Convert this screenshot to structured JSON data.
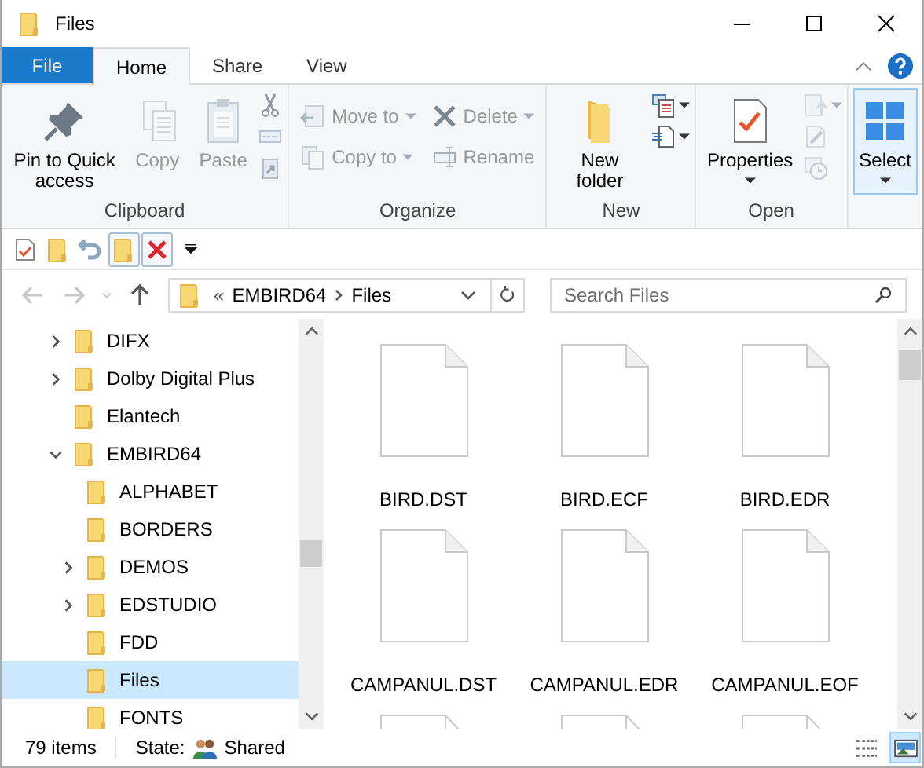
{
  "window": {
    "title": "Files"
  },
  "tabs": [
    {
      "label": "File",
      "kind": "file",
      "selected": false
    },
    {
      "label": "Home",
      "kind": "tab",
      "selected": true
    },
    {
      "label": "Share",
      "kind": "tab",
      "selected": false
    },
    {
      "label": "View",
      "kind": "tab",
      "selected": false
    }
  ],
  "ribbon": {
    "groups": [
      {
        "name": "Clipboard",
        "items": [
          {
            "kind": "large",
            "label": "Pin to Quick access",
            "disabled": false,
            "dropdown": false
          },
          {
            "kind": "large",
            "label": "Copy",
            "disabled": true,
            "dropdown": false
          },
          {
            "kind": "large",
            "label": "Paste",
            "disabled": true,
            "dropdown": false
          },
          {
            "kind": "stack",
            "buttons": [
              {
                "disabled": false,
                "dropdown": false
              },
              {
                "disabled": true,
                "dropdown": false
              },
              {
                "disabled": true,
                "dropdown": false
              }
            ]
          }
        ]
      },
      {
        "name": "Organize",
        "items": [
          {
            "kind": "column",
            "buttons": [
              {
                "label": "Move to",
                "disabled": true,
                "dropdown": true
              },
              {
                "label": "Copy to",
                "disabled": true,
                "dropdown": true
              }
            ]
          },
          {
            "kind": "column",
            "buttons": [
              {
                "label": "Delete",
                "disabled": true,
                "dropdown": true
              },
              {
                "label": "Rename",
                "disabled": true,
                "dropdown": false
              }
            ]
          }
        ]
      },
      {
        "name": "New",
        "items": [
          {
            "kind": "large",
            "label": "New folder",
            "disabled": false,
            "dropdown": false
          },
          {
            "kind": "stack",
            "buttons": [
              {
                "disabled": false,
                "dropdown": true
              },
              {
                "disabled": false,
                "dropdown": true
              }
            ]
          }
        ]
      },
      {
        "name": "Open",
        "items": [
          {
            "kind": "large",
            "label": "Properties",
            "disabled": false,
            "dropdown": true
          },
          {
            "kind": "stack",
            "buttons": [
              {
                "disabled": true,
                "dropdown": true
              },
              {
                "disabled": true,
                "dropdown": false
              },
              {
                "disabled": true,
                "dropdown": false
              }
            ]
          }
        ]
      },
      {
        "items": [
          {
            "kind": "large",
            "label": "Select",
            "disabled": false,
            "dropdown": true,
            "selected": true
          }
        ]
      }
    ]
  },
  "quick_access": [
    {
      "pressed": false
    },
    {
      "pressed": false
    },
    {
      "pressed": false
    },
    {
      "pressed": true
    },
    {
      "pressed": true
    }
  ],
  "nav_buttons": [
    {
      "disabled": true
    },
    {
      "disabled": true
    },
    {
      "disabled": true
    },
    {
      "disabled": false
    }
  ],
  "address": {
    "overflow": "«",
    "path": [
      "EMBIRD64",
      "Files"
    ]
  },
  "search": {
    "placeholder": "Search Files"
  },
  "tree": [
    {
      "label": "DIFX",
      "has_children": true,
      "expanded": false,
      "selected": false
    },
    {
      "label": "Dolby Digital Plus",
      "has_children": true,
      "expanded": false,
      "selected": false
    },
    {
      "label": "Elantech",
      "has_children": false,
      "selected": false
    },
    {
      "label": "EMBIRD64",
      "has_children": true,
      "expanded": true,
      "selected": false,
      "children": [
        {
          "label": "ALPHABET",
          "has_children": false,
          "selected": false
        },
        {
          "label": "BORDERS",
          "has_children": false,
          "selected": false
        },
        {
          "label": "DEMOS",
          "has_children": true,
          "expanded": false,
          "selected": false
        },
        {
          "label": "EDSTUDIO",
          "has_children": true,
          "expanded": false,
          "selected": false
        },
        {
          "label": "FDD",
          "has_children": false,
          "selected": false
        },
        {
          "label": "Files",
          "has_children": false,
          "selected": true
        },
        {
          "label": "FONTS",
          "has_children": false,
          "selected": false
        }
      ]
    }
  ],
  "files": [
    {
      "kind": "file",
      "name": "BIRD.DST"
    },
    {
      "kind": "file",
      "name": "BIRD.ECF"
    },
    {
      "kind": "file",
      "name": "BIRD.EDR"
    },
    {
      "kind": "file",
      "name": "CAMPANUL.DST"
    },
    {
      "kind": "file",
      "name": "CAMPANUL.EDR"
    },
    {
      "kind": "file",
      "name": "CAMPANUL.EOF"
    },
    {
      "kind": "partial"
    },
    {
      "kind": "partial"
    },
    {
      "kind": "partial"
    }
  ],
  "status_bar": {
    "count": "79 items",
    "state_label": "State:",
    "state_value": "Shared",
    "views": [
      {
        "kind": "details",
        "selected": false
      },
      {
        "kind": "large-icons",
        "selected": true
      }
    ]
  }
}
